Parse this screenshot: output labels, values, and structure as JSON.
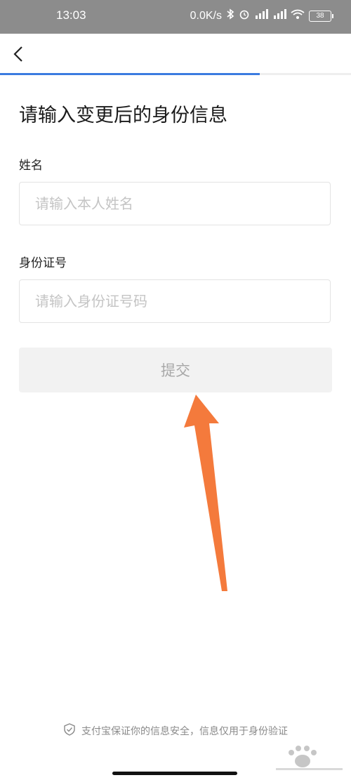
{
  "status_bar": {
    "time": "13:03",
    "net_speed": "0.0K/s",
    "battery": "38"
  },
  "nav": {
    "progress_percent": 74
  },
  "title": "请输入变更后的身份信息",
  "name_field": {
    "label": "姓名",
    "placeholder": "请输入本人姓名",
    "value": ""
  },
  "id_field": {
    "label": "身份证号",
    "placeholder": "请输入身份证号码",
    "value": ""
  },
  "submit": {
    "label": "提交"
  },
  "footer": {
    "text": "支付宝保证你的信息安全，信息仅用于身份验证"
  },
  "annotation": {
    "arrow_color": "#f47a3c"
  },
  "colors": {
    "accent": "#3b7be0",
    "status_bar": "#8c8c8c"
  }
}
